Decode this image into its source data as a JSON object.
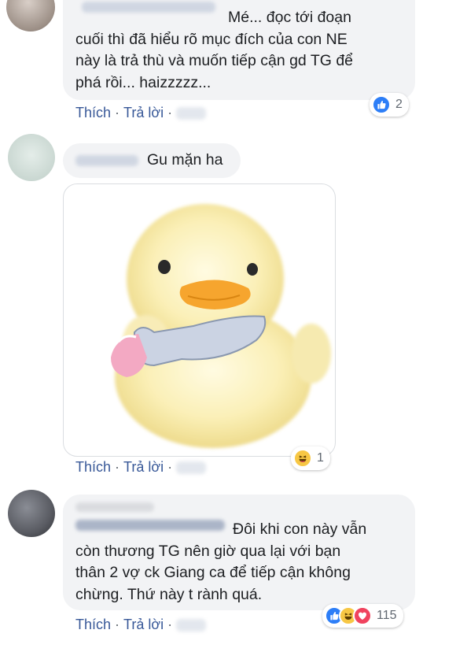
{
  "comments": [
    {
      "text": "Mé... đọc tới đoạn\ncuối thì đã hiểu rõ mục đích của con NE\nnày là trả thù và muốn tiếp cận gd TG để\nphá rồi... haizzzzz...",
      "reaction_count": "2",
      "reactions": [
        "like-icon"
      ]
    },
    {
      "text": "Gu mặn ha",
      "reaction_count": "1",
      "reactions": [
        "haha-icon"
      ]
    },
    {
      "text": "Đôi khi con này vẫn\ncòn thương TG nên giờ qua lại với bạn\nthân 2 vợ ck Giang ca để tiếp cận không\nchừng. Thứ này t rành quá.",
      "reaction_count": "115",
      "reactions": [
        "like-icon",
        "haha-icon",
        "love-icon"
      ]
    }
  ],
  "actions": {
    "like": "Thích",
    "reply": "Trả lời",
    "separator": "·"
  },
  "colors": {
    "link": "#385898",
    "bubble": "#f2f3f5",
    "like": "#2d7ef7",
    "haha": "#f7c744",
    "love": "#f0435e"
  }
}
